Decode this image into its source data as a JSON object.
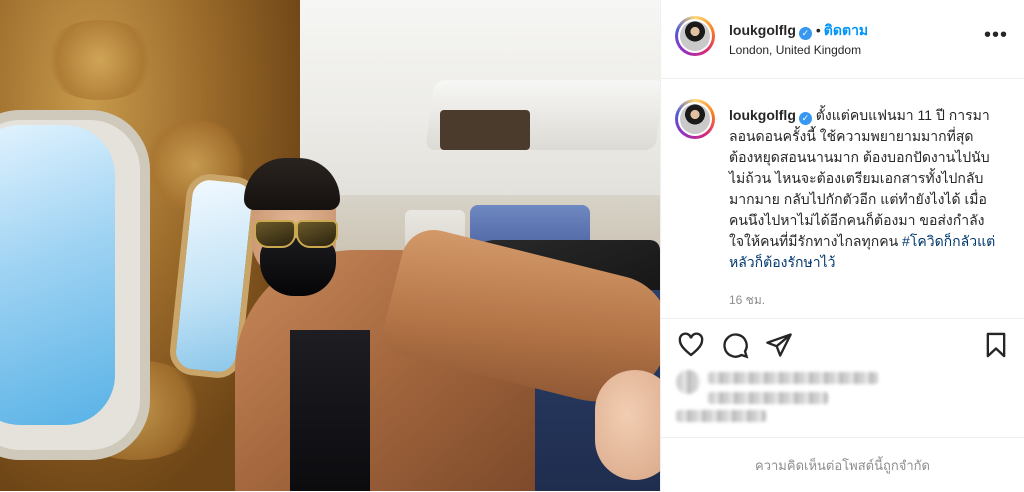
{
  "post": {
    "username": "loukgolflg",
    "verified": true,
    "follow_label": "ติดตาม",
    "location": "London, United Kingdom",
    "more_icon": "more-horizontal-icon"
  },
  "caption": {
    "username": "loukgolflg",
    "text": "ตั้งแต่คบแฟนมา 11 ปี การมาลอนดอนครั้งนี้ ใช้ความพยายามมากที่สุด ต้องหยุดสอนนานมาก ต้องบอกปัดงานไปนับไม่ถ้วน ไหนจะต้องเตรียมเอกสารทั้งไปกลับมากมาย กลับไปกักตัวอีก แต่ทำยังไงได้ เมื่อคนนึงไปหาไม่ได้อีกคนก็ต้องมา ขอส่งกำลังใจให้คนที่มีรักทางไกลทุกคน",
    "hashtag": "#โควิดก็กลัวแต่หลัวก็ต้องรักษาไว้",
    "time_ago": "16 ชม."
  },
  "actions": {
    "like_icon": "heart-icon",
    "comment_icon": "comment-icon",
    "share_icon": "share-icon",
    "save_icon": "bookmark-icon"
  },
  "footer": {
    "comments_limited": "ความคิดเห็นต่อโพสต์นี้ถูกจำกัด"
  },
  "colors": {
    "link_blue": "#0095f6",
    "verified_blue": "#3897f0",
    "hashtag_navy": "#00376b",
    "muted_gray": "#8e8e8e",
    "border": "#efefef"
  }
}
